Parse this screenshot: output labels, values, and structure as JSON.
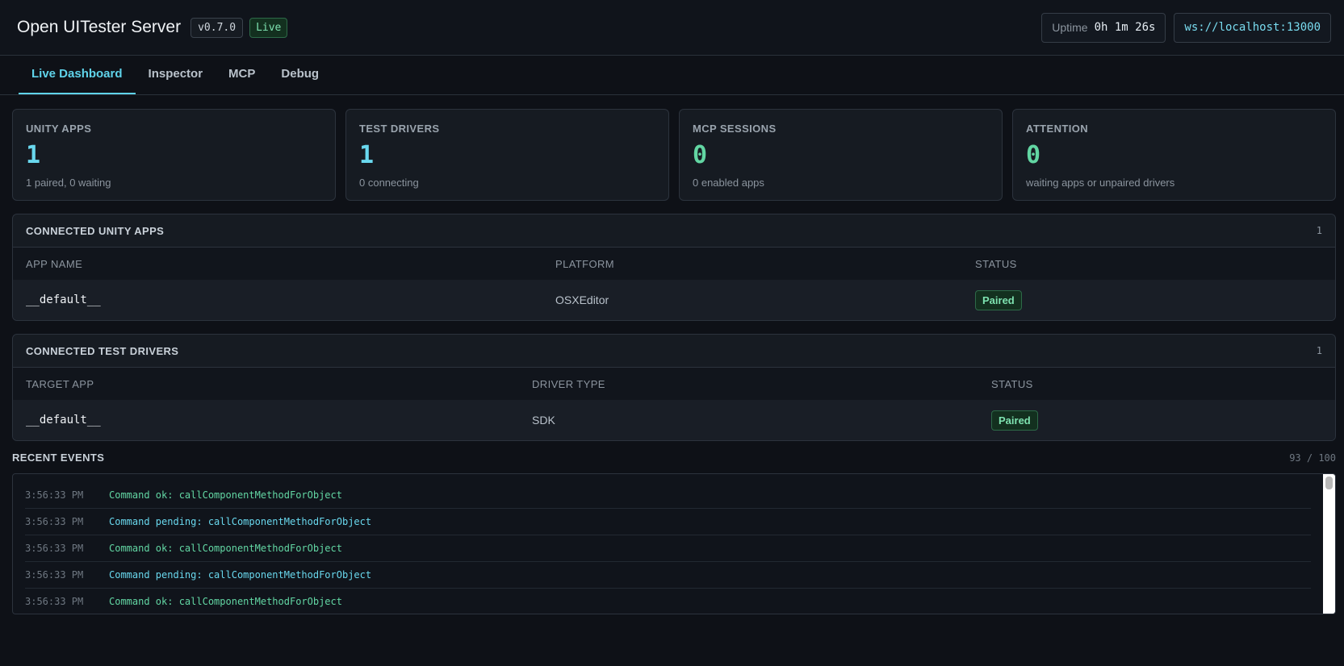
{
  "header": {
    "title": "Open UITester Server",
    "version": "v0.7.0",
    "live_label": "Live",
    "uptime_label": "Uptime",
    "uptime_value": "0h 1m 26s",
    "ws_url": "ws://localhost:13000"
  },
  "tabs": [
    {
      "label": "Live Dashboard",
      "active": true
    },
    {
      "label": "Inspector",
      "active": false
    },
    {
      "label": "MCP",
      "active": false
    },
    {
      "label": "Debug",
      "active": false
    }
  ],
  "stats": [
    {
      "label": "UNITY APPS",
      "value": "1",
      "sub": "1 paired, 0 waiting",
      "color": "#69d8ee"
    },
    {
      "label": "TEST DRIVERS",
      "value": "1",
      "sub": "0 connecting",
      "color": "#69d8ee"
    },
    {
      "label": "MCP SESSIONS",
      "value": "0",
      "sub": "0 enabled apps",
      "color": "#62d6a3"
    },
    {
      "label": "ATTENTION",
      "value": "0",
      "sub": "waiting apps or unpaired drivers",
      "color": "#62d6a3"
    }
  ],
  "unity_apps": {
    "title": "CONNECTED UNITY APPS",
    "count": "1",
    "columns": [
      "APP NAME",
      "PLATFORM",
      "STATUS"
    ],
    "rows": [
      {
        "app_name": "__default__",
        "platform": "OSXEditor",
        "status": "Paired"
      }
    ]
  },
  "test_drivers": {
    "title": "CONNECTED TEST DRIVERS",
    "count": "1",
    "columns": [
      "TARGET APP",
      "DRIVER TYPE",
      "STATUS"
    ],
    "rows": [
      {
        "target_app": "__default__",
        "driver_type": "SDK",
        "status": "Paired"
      }
    ]
  },
  "events": {
    "title": "RECENT EVENTS",
    "count": "93 / 100",
    "items": [
      {
        "time": "3:56:33 PM",
        "message": "Command ok: callComponentMethodForObject",
        "kind": "ok"
      },
      {
        "time": "3:56:33 PM",
        "message": "Command pending: callComponentMethodForObject",
        "kind": "pending"
      },
      {
        "time": "3:56:33 PM",
        "message": "Command ok: callComponentMethodForObject",
        "kind": "ok"
      },
      {
        "time": "3:56:33 PM",
        "message": "Command pending: callComponentMethodForObject",
        "kind": "pending"
      },
      {
        "time": "3:56:33 PM",
        "message": "Command ok: callComponentMethodForObject",
        "kind": "ok"
      }
    ]
  }
}
